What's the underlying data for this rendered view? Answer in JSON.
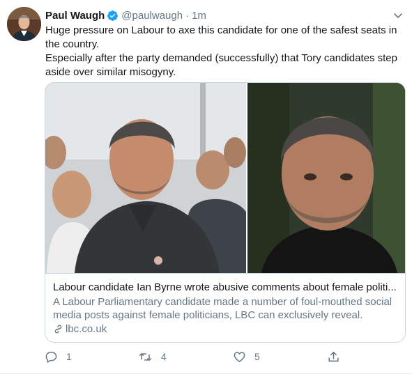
{
  "tweet": {
    "author": {
      "display_name": "Paul Waugh",
      "handle": "@paulwaugh",
      "verified": true
    },
    "separator": "·",
    "time": "1m",
    "text_line_1": "Huge pressure on Labour to axe this candidate for one of the safest seats in the country.",
    "text_line_2": "Especially after the party demanded (successfully) that Tory candidates step aside over similar misogyny."
  },
  "card": {
    "title": "Labour candidate Ian Byrne wrote abusive comments about female politi...",
    "description": "A Labour Parliamentary candidate made a number of foul-mouthed social media posts against female politicians, LBC can exclusively reveal.",
    "domain": "lbc.co.uk"
  },
  "actions": {
    "replies": "1",
    "retweets": "4",
    "likes": "5"
  },
  "icons": {
    "verified": "verified-badge-icon",
    "caret": "chevron-down-icon",
    "link": "link-icon",
    "reply": "reply-icon",
    "retweet": "retweet-icon",
    "like": "heart-icon",
    "share": "share-icon"
  },
  "colors": {
    "accent": "#1da1f2",
    "text_primary": "#14171a",
    "text_secondary": "#657786",
    "border": "#ccd6dd"
  }
}
